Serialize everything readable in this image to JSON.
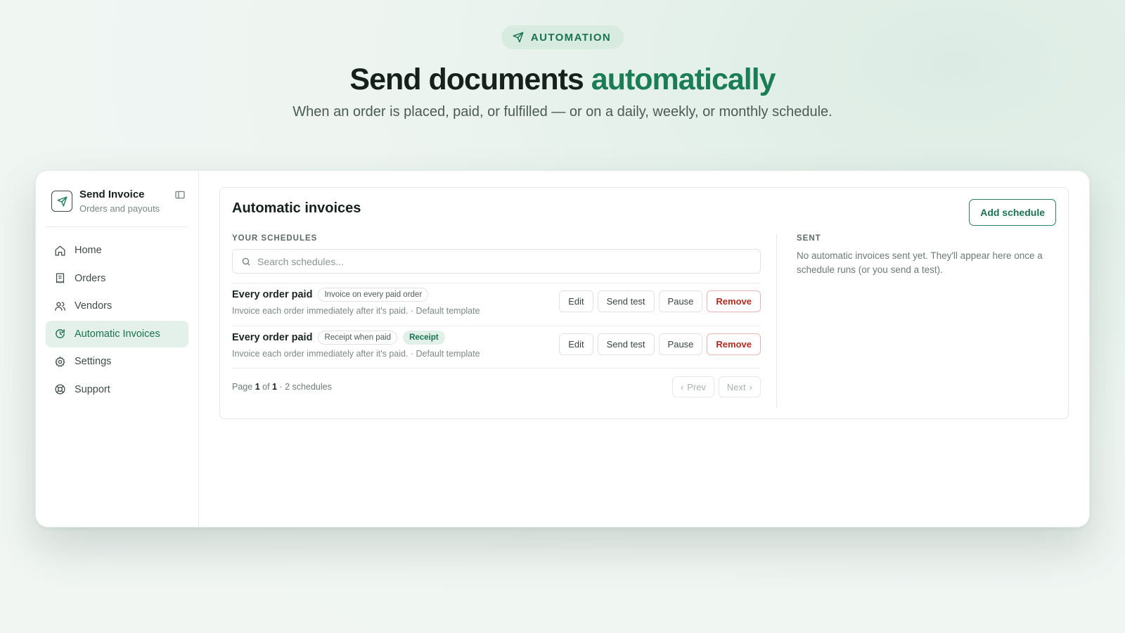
{
  "hero": {
    "badge": "AUTOMATION",
    "title_main": "Send documents",
    "title_accent": "automatically",
    "subtitle": "When an order is placed, paid, or fulfilled — or on a daily, weekly, or monthly schedule."
  },
  "sidebar": {
    "brand_name": "Send Invoice",
    "brand_sub": "Orders and payouts",
    "items": [
      {
        "label": "Home",
        "icon": "home-icon"
      },
      {
        "label": "Orders",
        "icon": "receipt-icon"
      },
      {
        "label": "Vendors",
        "icon": "users-icon"
      },
      {
        "label": "Automatic Invoices",
        "icon": "refresh-icon",
        "active": true
      },
      {
        "label": "Settings",
        "icon": "gear-icon"
      },
      {
        "label": "Support",
        "icon": "lifebuoy-icon"
      }
    ]
  },
  "main": {
    "title": "Automatic invoices",
    "add_button": "Add schedule",
    "schedules_label": "YOUR SCHEDULES",
    "search_placeholder": "Search schedules...",
    "schedules": [
      {
        "name": "Every order paid",
        "tag": "Invoice on every paid order",
        "badge": "",
        "description": "Invoice each order immediately after it's paid. · Default template"
      },
      {
        "name": "Every order paid",
        "tag": "Receipt when paid",
        "badge": "Receipt",
        "description": "Invoice each order immediately after it's paid. · Default template"
      }
    ],
    "actions": {
      "edit": "Edit",
      "send_test": "Send test",
      "pause": "Pause",
      "remove": "Remove"
    },
    "pager": {
      "prefix": "Page",
      "page": "1",
      "of": "of",
      "total": "1",
      "count": "· 2 schedules",
      "prev": "Prev",
      "next": "Next"
    },
    "sent_label": "SENT",
    "sent_text": "No automatic invoices sent yet. They'll appear here once a schedule runs (or you send a test)."
  },
  "colors": {
    "accent": "#1a7d56",
    "danger": "#b22a20"
  }
}
